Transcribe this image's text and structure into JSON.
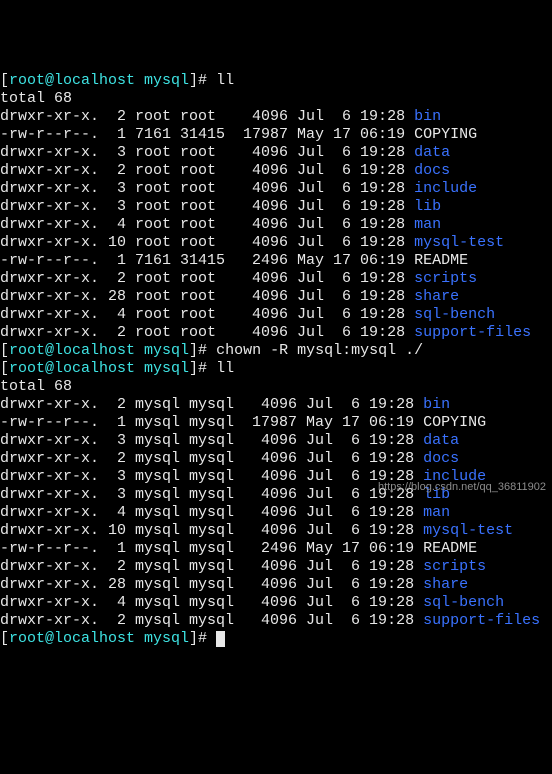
{
  "prompt_prefix_open": "[",
  "prompt_usercwd": "root@localhost mysql",
  "prompt_suffix": "]# ",
  "cmd_ll": "ll",
  "cmd_chown": "chown -R mysql:mysql ./",
  "totals": {
    "t1": "total 68",
    "t2": "total 68"
  },
  "ls1": [
    {
      "perm": "drwxr-xr-x.",
      "n": "  2",
      "own": " root",
      "grp": " root ",
      "size": "   4096",
      "mon": " Jul",
      "d": "  6",
      "time": " 19:28 ",
      "fname": "bin",
      "color": "blue"
    },
    {
      "perm": "-rw-r--r--.",
      "n": "  1",
      "own": " 7161",
      "grp": " 31415",
      "size": "  17987",
      "mon": " May",
      "d": " 17",
      "time": " 06:19 ",
      "fname": "COPYING",
      "color": "white"
    },
    {
      "perm": "drwxr-xr-x.",
      "n": "  3",
      "own": " root",
      "grp": " root ",
      "size": "   4096",
      "mon": " Jul",
      "d": "  6",
      "time": " 19:28 ",
      "fname": "data",
      "color": "blue"
    },
    {
      "perm": "drwxr-xr-x.",
      "n": "  2",
      "own": " root",
      "grp": " root ",
      "size": "   4096",
      "mon": " Jul",
      "d": "  6",
      "time": " 19:28 ",
      "fname": "docs",
      "color": "blue"
    },
    {
      "perm": "drwxr-xr-x.",
      "n": "  3",
      "own": " root",
      "grp": " root ",
      "size": "   4096",
      "mon": " Jul",
      "d": "  6",
      "time": " 19:28 ",
      "fname": "include",
      "color": "blue"
    },
    {
      "perm": "drwxr-xr-x.",
      "n": "  3",
      "own": " root",
      "grp": " root ",
      "size": "   4096",
      "mon": " Jul",
      "d": "  6",
      "time": " 19:28 ",
      "fname": "lib",
      "color": "blue"
    },
    {
      "perm": "drwxr-xr-x.",
      "n": "  4",
      "own": " root",
      "grp": " root ",
      "size": "   4096",
      "mon": " Jul",
      "d": "  6",
      "time": " 19:28 ",
      "fname": "man",
      "color": "blue"
    },
    {
      "perm": "drwxr-xr-x.",
      "n": " 10",
      "own": " root",
      "grp": " root ",
      "size": "   4096",
      "mon": " Jul",
      "d": "  6",
      "time": " 19:28 ",
      "fname": "mysql-test",
      "color": "blue"
    },
    {
      "perm": "-rw-r--r--.",
      "n": "  1",
      "own": " 7161",
      "grp": " 31415",
      "size": "   2496",
      "mon": " May",
      "d": " 17",
      "time": " 06:19 ",
      "fname": "README",
      "color": "white"
    },
    {
      "perm": "drwxr-xr-x.",
      "n": "  2",
      "own": " root",
      "grp": " root ",
      "size": "   4096",
      "mon": " Jul",
      "d": "  6",
      "time": " 19:28 ",
      "fname": "scripts",
      "color": "blue"
    },
    {
      "perm": "drwxr-xr-x.",
      "n": " 28",
      "own": " root",
      "grp": " root ",
      "size": "   4096",
      "mon": " Jul",
      "d": "  6",
      "time": " 19:28 ",
      "fname": "share",
      "color": "blue"
    },
    {
      "perm": "drwxr-xr-x.",
      "n": "  4",
      "own": " root",
      "grp": " root ",
      "size": "   4096",
      "mon": " Jul",
      "d": "  6",
      "time": " 19:28 ",
      "fname": "sql-bench",
      "color": "blue"
    },
    {
      "perm": "drwxr-xr-x.",
      "n": "  2",
      "own": " root",
      "grp": " root ",
      "size": "   4096",
      "mon": " Jul",
      "d": "  6",
      "time": " 19:28 ",
      "fname": "support-files",
      "color": "blue"
    }
  ],
  "ls2": [
    {
      "perm": "drwxr-xr-x.",
      "n": "  2",
      "own": " mysql",
      "grp": " mysql",
      "size": "   4096",
      "mon": " Jul",
      "d": "  6",
      "time": " 19:28 ",
      "fname": "bin",
      "color": "blue"
    },
    {
      "perm": "-rw-r--r--.",
      "n": "  1",
      "own": " mysql",
      "grp": " mysql",
      "size": "  17987",
      "mon": " May",
      "d": " 17",
      "time": " 06:19 ",
      "fname": "COPYING",
      "color": "white"
    },
    {
      "perm": "drwxr-xr-x.",
      "n": "  3",
      "own": " mysql",
      "grp": " mysql",
      "size": "   4096",
      "mon": " Jul",
      "d": "  6",
      "time": " 19:28 ",
      "fname": "data",
      "color": "blue"
    },
    {
      "perm": "drwxr-xr-x.",
      "n": "  2",
      "own": " mysql",
      "grp": " mysql",
      "size": "   4096",
      "mon": " Jul",
      "d": "  6",
      "time": " 19:28 ",
      "fname": "docs",
      "color": "blue"
    },
    {
      "perm": "drwxr-xr-x.",
      "n": "  3",
      "own": " mysql",
      "grp": " mysql",
      "size": "   4096",
      "mon": " Jul",
      "d": "  6",
      "time": " 19:28 ",
      "fname": "include",
      "color": "blue"
    },
    {
      "perm": "drwxr-xr-x.",
      "n": "  3",
      "own": " mysql",
      "grp": " mysql",
      "size": "   4096",
      "mon": " Jul",
      "d": "  6",
      "time": " 19:28 ",
      "fname": "lib",
      "color": "blue"
    },
    {
      "perm": "drwxr-xr-x.",
      "n": "  4",
      "own": " mysql",
      "grp": " mysql",
      "size": "   4096",
      "mon": " Jul",
      "d": "  6",
      "time": " 19:28 ",
      "fname": "man",
      "color": "blue"
    },
    {
      "perm": "drwxr-xr-x.",
      "n": " 10",
      "own": " mysql",
      "grp": " mysql",
      "size": "   4096",
      "mon": " Jul",
      "d": "  6",
      "time": " 19:28 ",
      "fname": "mysql-test",
      "color": "blue"
    },
    {
      "perm": "-rw-r--r--.",
      "n": "  1",
      "own": " mysql",
      "grp": " mysql",
      "size": "   2496",
      "mon": " May",
      "d": " 17",
      "time": " 06:19 ",
      "fname": "README",
      "color": "white"
    },
    {
      "perm": "drwxr-xr-x.",
      "n": "  2",
      "own": " mysql",
      "grp": " mysql",
      "size": "   4096",
      "mon": " Jul",
      "d": "  6",
      "time": " 19:28 ",
      "fname": "scripts",
      "color": "blue"
    },
    {
      "perm": "drwxr-xr-x.",
      "n": " 28",
      "own": " mysql",
      "grp": " mysql",
      "size": "   4096",
      "mon": " Jul",
      "d": "  6",
      "time": " 19:28 ",
      "fname": "share",
      "color": "blue"
    },
    {
      "perm": "drwxr-xr-x.",
      "n": "  4",
      "own": " mysql",
      "grp": " mysql",
      "size": "   4096",
      "mon": " Jul",
      "d": "  6",
      "time": " 19:28 ",
      "fname": "sql-bench",
      "color": "blue"
    },
    {
      "perm": "drwxr-xr-x.",
      "n": "  2",
      "own": " mysql",
      "grp": " mysql",
      "size": "   4096",
      "mon": " Jul",
      "d": "  6",
      "time": " 19:28 ",
      "fname": "support-files",
      "color": "blue"
    }
  ],
  "watermark": "https://blog.csdn.net/qq_36811902"
}
